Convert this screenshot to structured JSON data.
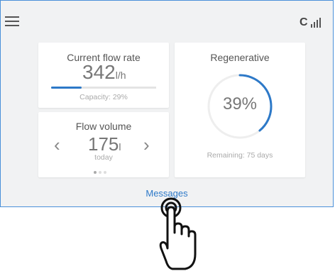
{
  "header": {
    "brand": "C",
    "menu_icon": "hamburger-menu-icon",
    "signal_icon": "signal-bars-icon"
  },
  "flow_rate": {
    "title": "Current flow rate",
    "value": "342",
    "unit": "l/h",
    "capacity_text": "Capacity: 29%",
    "capacity_percent": 29
  },
  "flow_volume": {
    "title": "Flow volume",
    "value": "175",
    "unit": "l",
    "period": "today",
    "prev_icon": "chevron-left-icon",
    "next_icon": "chevron-right-icon",
    "page_indicator": {
      "total": 3,
      "active": 1
    }
  },
  "regenerative": {
    "title": "Regenerative",
    "percent_label": "39%",
    "percent": 39,
    "remaining_text": "Remaining: 75 days"
  },
  "footer": {
    "messages_label": "Messages"
  },
  "colors": {
    "accent": "#2d79c8",
    "border": "#4a90d9",
    "background": "#f1f2f3"
  },
  "pointer": {
    "icon": "hand-pointer-icon"
  }
}
